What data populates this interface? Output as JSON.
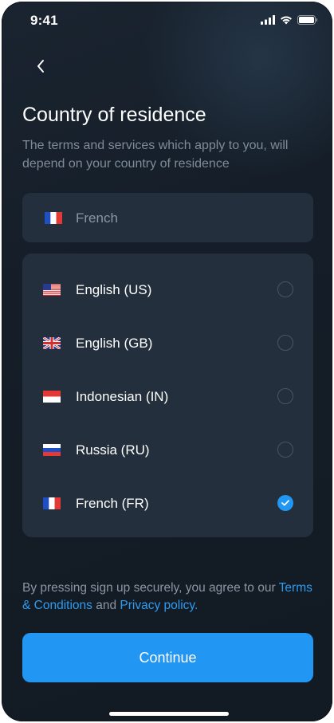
{
  "status_bar": {
    "time": "9:41"
  },
  "header": {
    "title": "Country of residence",
    "subtitle": "The terms and services which apply to you, will depend on your country of residence"
  },
  "search": {
    "value": "French",
    "flag": "fr-flag"
  },
  "languages": [
    {
      "label": "English (US)",
      "flag": "us-flag",
      "selected": false
    },
    {
      "label": "English (GB)",
      "flag": "gb-flag",
      "selected": false
    },
    {
      "label": "Indonesian (IN)",
      "flag": "id-flag",
      "selected": false
    },
    {
      "label": "Russia (RU)",
      "flag": "ru-flag",
      "selected": false
    },
    {
      "label": "French (FR)",
      "flag": "fr-flag",
      "selected": true
    }
  ],
  "legal": {
    "prefix": "By pressing sign up securely, you agree to our",
    "terms_link": "Terms & Conditions",
    "middle": "and",
    "privacy_link": "Privacy policy."
  },
  "continue_label": "Continue",
  "colors": {
    "accent": "#2196f3",
    "background": "#151e28",
    "card": "#232f3c",
    "link": "#2f9bef"
  }
}
